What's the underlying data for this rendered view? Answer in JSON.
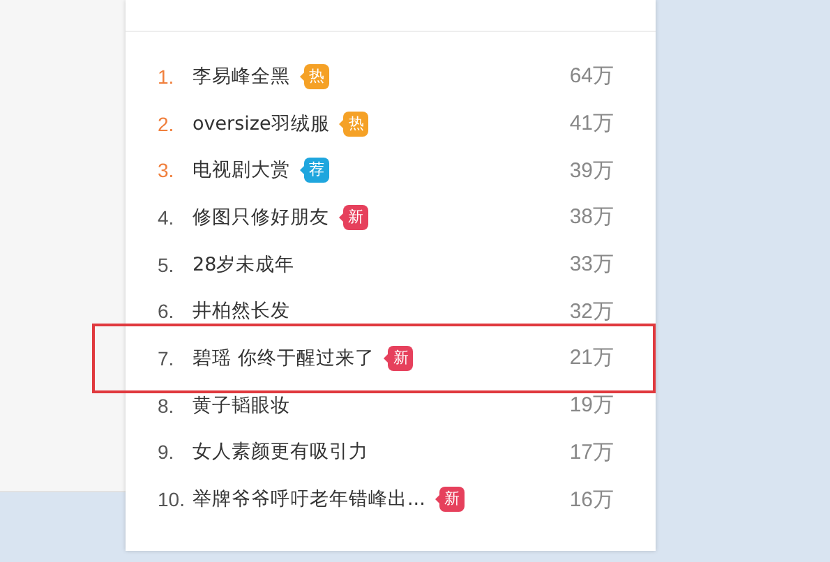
{
  "rows": [
    {
      "rank": "1.",
      "title": "李易峰全黑",
      "badge": {
        "text": "热",
        "kind": "hot"
      },
      "count": "64万",
      "highlighted": false
    },
    {
      "rank": "2.",
      "title": "oversize羽绒服",
      "badge": {
        "text": "热",
        "kind": "hot"
      },
      "count": "41万",
      "highlighted": false
    },
    {
      "rank": "3.",
      "title": "电视剧大赏",
      "badge": {
        "text": "荐",
        "kind": "recommended"
      },
      "count": "39万",
      "highlighted": false
    },
    {
      "rank": "4.",
      "title": "修图只修好朋友",
      "badge": {
        "text": "新",
        "kind": "new"
      },
      "count": "38万",
      "highlighted": false
    },
    {
      "rank": "5.",
      "title": "28岁未成年",
      "count": "33万",
      "highlighted": false
    },
    {
      "rank": "6.",
      "title": "井柏然长发",
      "count": "32万",
      "highlighted": false
    },
    {
      "rank": "7.",
      "title": "碧瑶 你终于醒过来了",
      "badge": {
        "text": "新",
        "kind": "new"
      },
      "count": "21万",
      "highlighted": true
    },
    {
      "rank": "8.",
      "title": "黄子韬眼妆",
      "count": "19万",
      "highlighted": false
    },
    {
      "rank": "9.",
      "title": "女人素颜更有吸引力",
      "count": "17万",
      "highlighted": false
    },
    {
      "rank": "10.",
      "title": "举牌爷爷呼吁老年错峰出...",
      "badge": {
        "text": "新",
        "kind": "new"
      },
      "count": "16万",
      "highlighted": false
    }
  ]
}
